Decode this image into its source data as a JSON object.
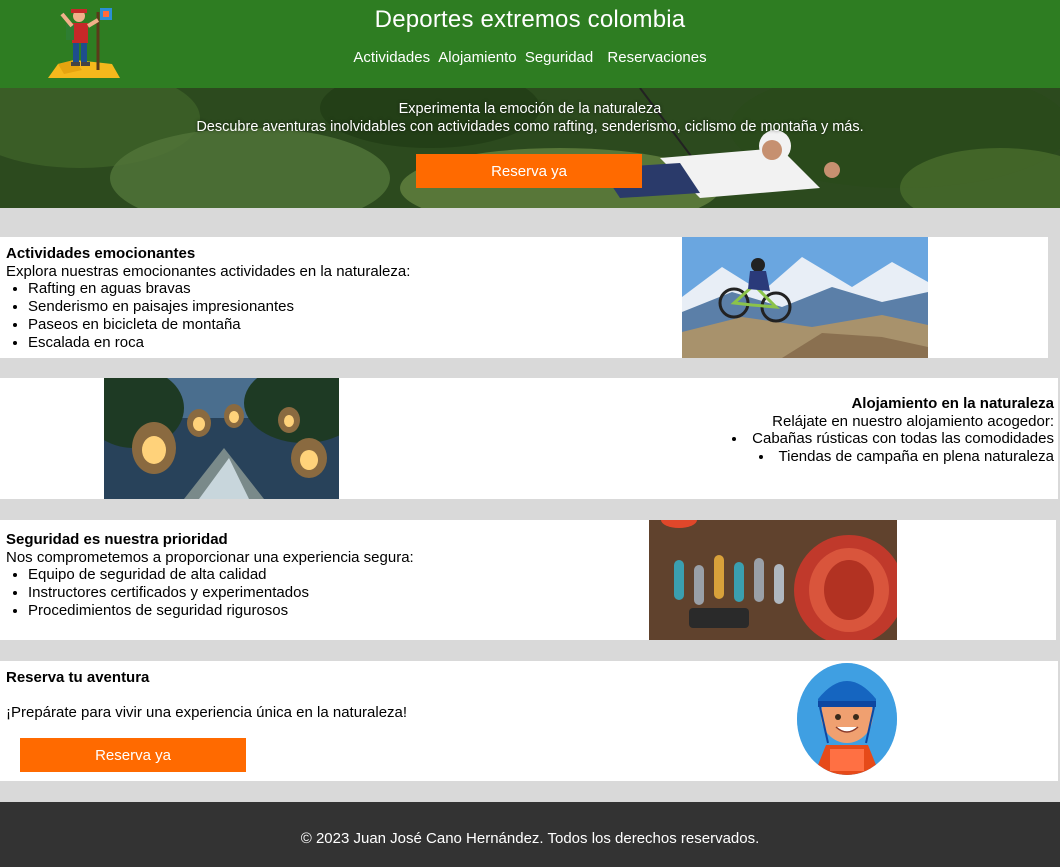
{
  "header": {
    "title": "Deportes extremos colombia",
    "nav": [
      "Actividades",
      "Alojamiento",
      "Seguridad",
      "Reservaciones"
    ]
  },
  "hero": {
    "line1": "Experimenta la emoción de la naturaleza",
    "line2": "Descubre aventuras inolvidables con actividades como rafting, senderismo, ciclismo de montaña y más.",
    "button": "Reserva ya"
  },
  "activities": {
    "title": "Actividades emocionantes",
    "intro": "Explora nuestras emocionantes actividades en la naturaleza:",
    "items": [
      "Rafting en aguas bravas",
      "Senderismo en paisajes impresionantes",
      "Paseos en bicicleta de montaña",
      "Escalada en roca"
    ]
  },
  "lodging": {
    "title": "Alojamiento en la naturaleza",
    "intro": "Relájate en nuestro alojamiento acogedor:",
    "items": [
      "Cabañas rústicas con todas las comodidades",
      "Tiendas de campaña en plena naturaleza"
    ]
  },
  "safety": {
    "title": "Seguridad es nuestra prioridad",
    "intro": "Nos comprometemos a proporcionar una experiencia segura:",
    "items": [
      "Equipo de seguridad de alta calidad",
      "Instructores certificados y experimentados",
      "Procedimientos de seguridad rigurosos"
    ]
  },
  "booking": {
    "title": "Reserva tu aventura",
    "text": "¡Prepárate para vivir una experiencia única en la naturaleza!",
    "button": "Reserva ya"
  },
  "footer": {
    "text": "© 2023 Juan José Cano Hernández. Todos los derechos reservados."
  },
  "colors": {
    "header": "#2e7d22",
    "accent": "#ff6a00",
    "footer": "#333333",
    "page_bg": "#d9d9d9"
  }
}
